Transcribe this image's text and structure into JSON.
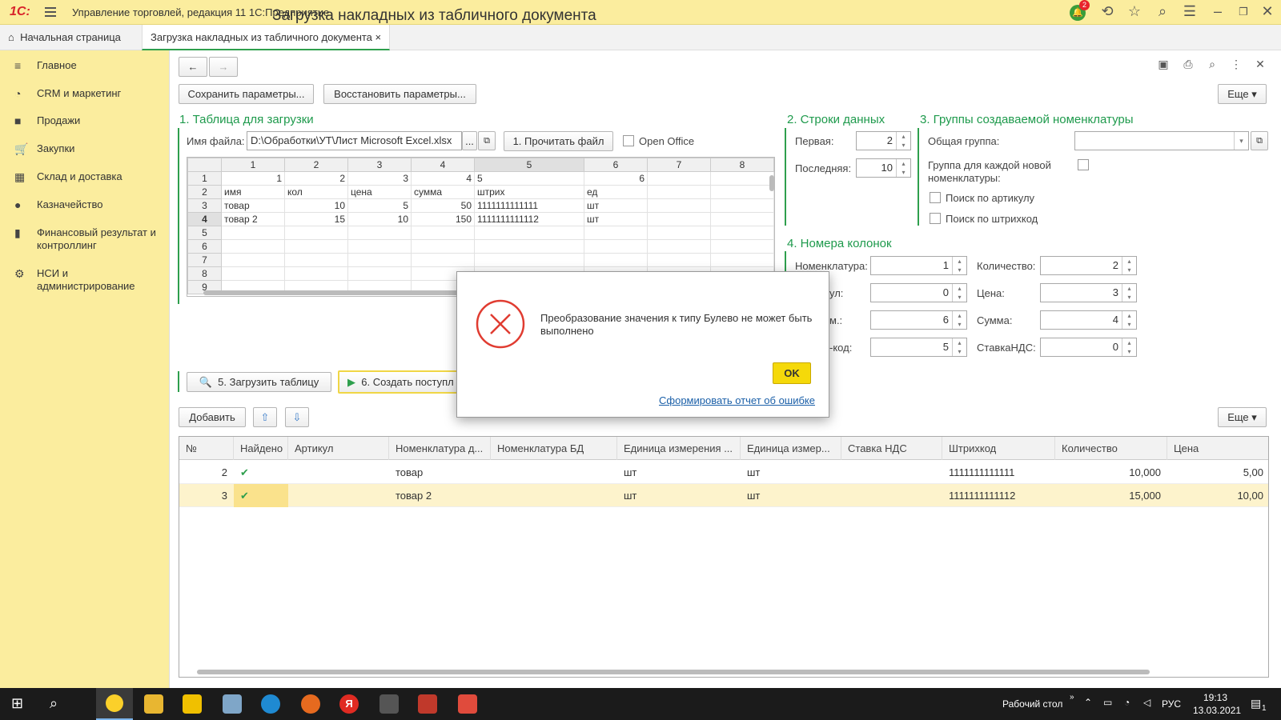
{
  "titlebar": {
    "logo": "1С:",
    "title": "Управление торговлей, редакция 11 1С:Предприятие",
    "notif_count": "2"
  },
  "tabs": {
    "home": "Начальная страница",
    "current": "Загрузка накладных из табличного документа",
    "close": "×"
  },
  "sidebar": {
    "items": [
      {
        "label": "Главное",
        "icon": "≡"
      },
      {
        "label": "CRM и маркетинг",
        "icon": "◔"
      },
      {
        "label": "Продажи",
        "icon": "■"
      },
      {
        "label": "Закупки",
        "icon": "🛒"
      },
      {
        "label": "Склад и доставка",
        "icon": "▦"
      },
      {
        "label": "Казначейство",
        "icon": "●"
      },
      {
        "label": "Финансовый результат и контроллинг",
        "icon": "▮"
      },
      {
        "label": "НСИ и администрирование",
        "icon": "⚙"
      }
    ]
  },
  "form": {
    "title": "Загрузка накладных из табличного документа",
    "save_params": "Сохранить параметры...",
    "restore_params": "Восстановить параметры...",
    "more": "Еще ▾",
    "sec1": "1. Таблица для загрузки",
    "file_label": "Имя файла:",
    "file_value": "D:\\Обработки\\УТ\\Лист Microsoft Excel.xlsx",
    "read_file": "1. Прочитать файл",
    "open_office": "Open Office",
    "sec2": "2. Строки данных",
    "first_label": "Первая:",
    "first_value": "2",
    "last_label": "Последняя:",
    "last_value": "10",
    "sec3": "3. Группы создаваемой номенклатуры",
    "common_group": "Общая группа:",
    "group_each": "Группа для каждой новой номенклатуры:",
    "search_article": "Поиск по артикулу",
    "search_barcode": "Поиск по штрихкод",
    "sec4": "4. Номера колонок",
    "col_nomen": "Номенклатура:",
    "col_nomen_v": "1",
    "col_art": "ул:",
    "col_art_v": "0",
    "col_unit": "м.:",
    "col_unit_v": "6",
    "col_code": "-код:",
    "col_code_v": "5",
    "col_qty": "Количество:",
    "col_qty_v": "2",
    "col_price": "Цена:",
    "col_price_v": "3",
    "col_sum": "Сумма:",
    "col_sum_v": "4",
    "col_vat": "СтавкаНДС:",
    "col_vat_v": "0",
    "load_table": "5. Загрузить таблицу",
    "create_doc": "6. Создать поступл",
    "add": "Добавить"
  },
  "sheet": {
    "cols": [
      "1",
      "2",
      "3",
      "4",
      "5",
      "6",
      "7",
      "8"
    ],
    "rows": [
      [
        "1",
        "1",
        "2",
        "3",
        "4",
        "5",
        "6",
        "",
        ""
      ],
      [
        "2",
        "имя",
        "кол",
        "цена",
        "сумма",
        "штрих",
        "ед",
        "",
        ""
      ],
      [
        "3",
        "товар",
        "10",
        "5",
        "50",
        "1111111111111",
        "шт",
        "",
        ""
      ],
      [
        "4",
        "товар 2",
        "15",
        "10",
        "150",
        "1111111111112",
        "шт",
        "",
        ""
      ],
      [
        "5",
        "",
        "",
        "",
        "",
        "",
        "",
        "",
        ""
      ],
      [
        "6",
        "",
        "",
        "",
        "",
        "",
        "",
        "",
        ""
      ],
      [
        "7",
        "",
        "",
        "",
        "",
        "",
        "",
        "",
        ""
      ],
      [
        "8",
        "",
        "",
        "",
        "",
        "",
        "",
        "",
        ""
      ],
      [
        "9",
        "",
        "",
        "",
        "",
        "",
        "",
        "",
        ""
      ]
    ]
  },
  "grid": {
    "headers": [
      "№",
      "Найдено",
      "Артикул",
      "Номенклатура д...",
      "Номенклатура БД",
      "Единица измерения ...",
      "Единица измер...",
      "Ставка НДС",
      "Штрихкод",
      "Количество",
      "Цена"
    ],
    "rows": [
      {
        "n": "2",
        "found": "✔",
        "art": "",
        "nomen": "товар",
        "nomenbd": "",
        "unit": "шт",
        "unit2": "шт",
        "vat": "",
        "barcode": "1111111111111",
        "qty": "10,000",
        "price": "5,00"
      },
      {
        "n": "3",
        "found": "✔",
        "art": "",
        "nomen": "товар 2",
        "nomenbd": "",
        "unit": "шт",
        "unit2": "шт",
        "vat": "",
        "barcode": "1111111111112",
        "qty": "15,000",
        "price": "10,00"
      }
    ]
  },
  "dialog": {
    "message": "Преобразование значения к типу Булево не может быть выполнено",
    "ok": "OK",
    "report": "Сформировать отчет об ошибке"
  },
  "taskbar": {
    "desktop": "Рабочий стол",
    "lang": "РУС",
    "time": "19:13",
    "date": "13.03.2021",
    "notif": "1"
  },
  "colors": {
    "accent": "#2e9f4d",
    "panel": "#fbed9e",
    "ok_button": "#f5d90a",
    "error": "#e03c31"
  }
}
